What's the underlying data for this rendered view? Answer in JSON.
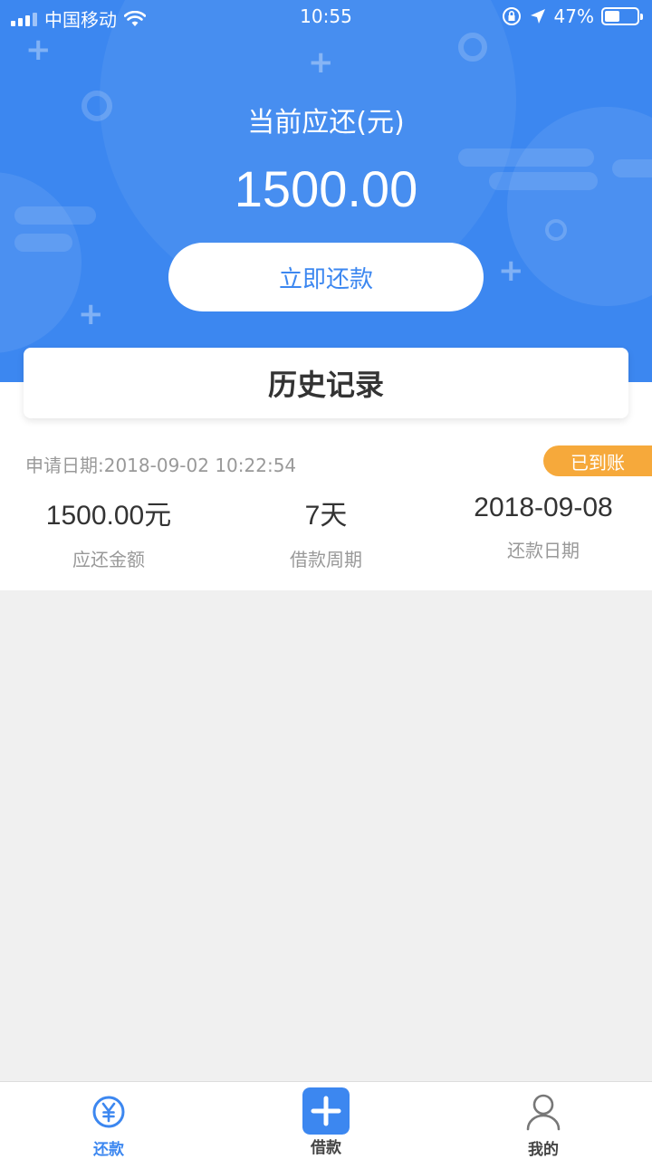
{
  "status_bar": {
    "carrier": "中国移动",
    "time": "10:55",
    "battery_percent": "47%",
    "battery_level": 0.47
  },
  "header": {
    "due_label": "当前应还(元)",
    "due_amount": "1500.00",
    "pay_button": "立即还款"
  },
  "history": {
    "title": "历史记录",
    "records": [
      {
        "apply_date": "申请日期:2018-09-02 10:22:54",
        "status": "已到账",
        "amount": "1500.00元",
        "amount_label": "应还金额",
        "period": "7天",
        "period_label": "借款周期",
        "repay_date": "2018-09-08",
        "repay_date_label": "还款日期"
      }
    ]
  },
  "tabbar": {
    "items": [
      {
        "label": "还款",
        "icon": "yen-circle-icon",
        "active": true
      },
      {
        "label": "借款",
        "icon": "plus-icon",
        "active": false
      },
      {
        "label": "我的",
        "icon": "person-icon",
        "active": false
      }
    ]
  },
  "colors": {
    "primary": "#3c87f0",
    "badge": "#f6a93b",
    "background": "#f0f0f0"
  }
}
